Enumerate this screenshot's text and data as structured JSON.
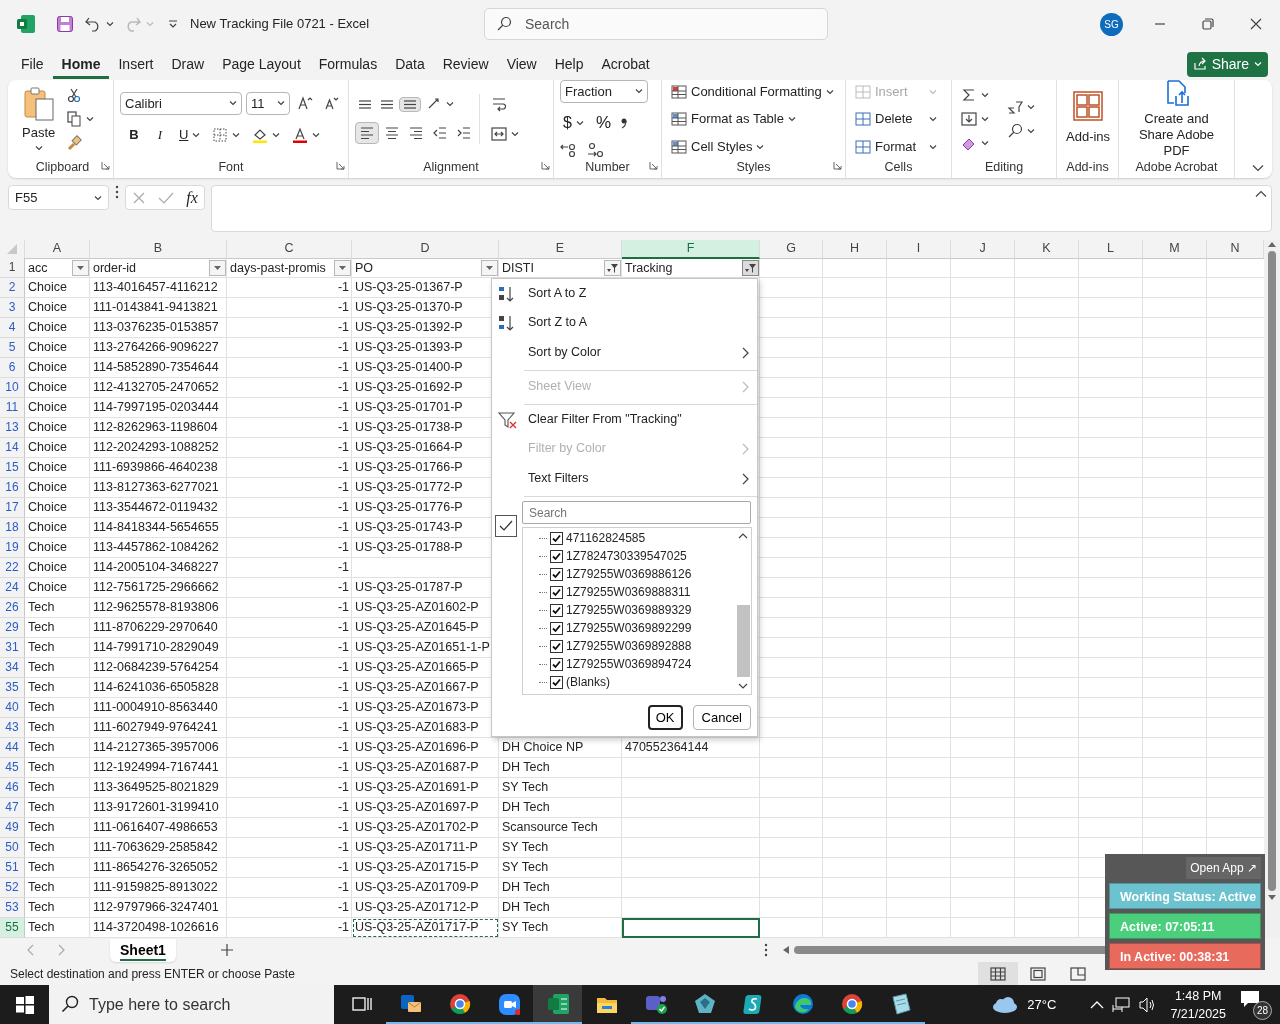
{
  "window": {
    "title": "New Tracking File 0721  -  Excel",
    "search_placeholder": "Search",
    "avatar": "SG"
  },
  "menu_tabs": [
    {
      "label": "File",
      "selected": false
    },
    {
      "label": "Home",
      "selected": true
    },
    {
      "label": "Insert",
      "selected": false
    },
    {
      "label": "Draw",
      "selected": false
    },
    {
      "label": "Page Layout",
      "selected": false
    },
    {
      "label": "Formulas",
      "selected": false
    },
    {
      "label": "Data",
      "selected": false
    },
    {
      "label": "Review",
      "selected": false
    },
    {
      "label": "View",
      "selected": false
    },
    {
      "label": "Help",
      "selected": false
    },
    {
      "label": "Acrobat",
      "selected": false
    }
  ],
  "share_button": "Share",
  "ribbon": {
    "groups": [
      {
        "kind": "clipboard",
        "label": "Clipboard",
        "button": "Paste",
        "launcher": true
      },
      {
        "kind": "font",
        "label": "Font",
        "font": "Calibri",
        "size": "11",
        "bold": "B",
        "italic": "I",
        "underline": "U",
        "launcher": true
      },
      {
        "kind": "alignment",
        "label": "Alignment",
        "vertical_align": [
          {
            "selected": false
          },
          {
            "selected": false
          },
          {
            "selected": true
          }
        ],
        "horizontal_align": [
          {
            "selected": true
          },
          {
            "selected": false
          },
          {
            "selected": false
          }
        ],
        "launcher": true
      },
      {
        "kind": "number",
        "label": "Number",
        "format": "Fraction",
        "currency": "$",
        "percent": "%",
        "launcher": true
      },
      {
        "kind": "styles",
        "label": "Styles",
        "items": [
          "Conditional Formatting",
          "Format as Table",
          "Cell Styles"
        ],
        "launcher": true
      },
      {
        "kind": "cells",
        "label": "Cells",
        "items": [
          {
            "label": "Insert",
            "disabled": true
          },
          {
            "label": "Delete",
            "disabled": false
          },
          {
            "label": "Format",
            "disabled": false
          }
        ],
        "launcher": false
      },
      {
        "kind": "editing",
        "label": "Editing",
        "launcher": false
      },
      {
        "kind": "addins",
        "label": "Add-ins",
        "button": "Add-ins",
        "launcher": false
      },
      {
        "kind": "acrobat",
        "label": "Adobe Acrobat",
        "button": "Create and Share Adobe PDF",
        "launcher": false
      }
    ]
  },
  "formula_bar": {
    "name_box": "F55",
    "fx": "fx"
  },
  "sheet": {
    "columns": [
      {
        "letter": "A",
        "kind": "text",
        "selected": false
      },
      {
        "letter": "B",
        "kind": "text",
        "selected": false
      },
      {
        "letter": "C",
        "kind": "number",
        "selected": false
      },
      {
        "letter": "D",
        "kind": "text",
        "selected": false
      },
      {
        "letter": "E",
        "kind": "text",
        "selected": false
      },
      {
        "letter": "F",
        "kind": "text",
        "selected": true
      },
      {
        "letter": "G",
        "kind": "text",
        "selected": false
      },
      {
        "letter": "H",
        "kind": "text",
        "selected": false
      },
      {
        "letter": "I",
        "kind": "text",
        "selected": false
      },
      {
        "letter": "J",
        "kind": "text",
        "selected": false
      },
      {
        "letter": "K",
        "kind": "text",
        "selected": false
      },
      {
        "letter": "L",
        "kind": "text",
        "selected": false
      },
      {
        "letter": "M",
        "kind": "text",
        "selected": false
      },
      {
        "letter": "N",
        "kind": "text",
        "selected": false
      }
    ],
    "header": {
      "num": "1",
      "cells": [
        {
          "text": "acc",
          "filtered": false
        },
        {
          "text": "order-id",
          "filtered": false
        },
        {
          "text": "days-past-promis",
          "filtered": false
        },
        {
          "text": "PO",
          "filtered": false
        },
        {
          "text": "DISTI",
          "filtered": true
        },
        {
          "text": "Tracking",
          "filtered": true
        }
      ]
    },
    "rows": [
      {
        "num": "2",
        "cells": [
          "Choice",
          "113-4016457-4116212",
          "-1",
          "US-Q3-25-01367-P"
        ],
        "selected": false
      },
      {
        "num": "3",
        "cells": [
          "Choice",
          "111-0143841-9413821",
          "-1",
          "US-Q3-25-01370-P"
        ],
        "selected": false
      },
      {
        "num": "4",
        "cells": [
          "Choice",
          "113-0376235-0153857",
          "-1",
          "US-Q3-25-01392-P"
        ],
        "selected": false
      },
      {
        "num": "5",
        "cells": [
          "Choice",
          "113-2764266-9096227",
          "-1",
          "US-Q3-25-01393-P"
        ],
        "selected": false
      },
      {
        "num": "6",
        "cells": [
          "Choice",
          "114-5852890-7354644",
          "-1",
          "US-Q3-25-01400-P"
        ],
        "selected": false
      },
      {
        "num": "10",
        "cells": [
          "Choice",
          "112-4132705-2470652",
          "-1",
          "US-Q3-25-01692-P"
        ],
        "selected": false
      },
      {
        "num": "11",
        "cells": [
          "Choice",
          "114-7997195-0203444",
          "-1",
          "US-Q3-25-01701-P"
        ],
        "selected": false
      },
      {
        "num": "13",
        "cells": [
          "Choice",
          "112-8262963-1198604",
          "-1",
          "US-Q3-25-01738-P"
        ],
        "selected": false
      },
      {
        "num": "14",
        "cells": [
          "Choice",
          "112-2024293-1088252",
          "-1",
          "US-Q3-25-01664-P"
        ],
        "selected": false
      },
      {
        "num": "15",
        "cells": [
          "Choice",
          "111-6939866-4640238",
          "-1",
          "US-Q3-25-01766-P"
        ],
        "selected": false
      },
      {
        "num": "16",
        "cells": [
          "Choice",
          "113-8127363-6277021",
          "-1",
          "US-Q3-25-01772-P"
        ],
        "selected": false
      },
      {
        "num": "17",
        "cells": [
          "Choice",
          "113-3544672-0119432",
          "-1",
          "US-Q3-25-01776-P"
        ],
        "selected": false
      },
      {
        "num": "18",
        "cells": [
          "Choice",
          "114-8418344-5654655",
          "-1",
          "US-Q3-25-01743-P"
        ],
        "selected": false
      },
      {
        "num": "19",
        "cells": [
          "Choice",
          "113-4457862-1084262",
          "-1",
          "US-Q3-25-01788-P"
        ],
        "selected": false
      },
      {
        "num": "22",
        "cells": [
          "Choice",
          "114-2005104-3468227",
          "-1"
        ],
        "selected": false
      },
      {
        "num": "24",
        "cells": [
          "Choice",
          "112-7561725-2966662",
          "-1",
          "US-Q3-25-01787-P"
        ],
        "selected": false
      },
      {
        "num": "26",
        "cells": [
          "Tech",
          "112-9625578-8193806",
          "-1",
          "US-Q3-25-AZ01602-P"
        ],
        "selected": false
      },
      {
        "num": "29",
        "cells": [
          "Tech",
          "111-8706229-2970640",
          "-1",
          "US-Q3-25-AZ01645-P"
        ],
        "selected": false
      },
      {
        "num": "31",
        "cells": [
          "Tech",
          "114-7991710-2829049",
          "-1",
          "US-Q3-25-AZ01651-1-P"
        ],
        "selected": false
      },
      {
        "num": "34",
        "cells": [
          "Tech",
          "112-0684239-5764254",
          "-1",
          "US-Q3-25-AZ01665-P"
        ],
        "selected": false
      },
      {
        "num": "35",
        "cells": [
          "Tech",
          "114-6241036-6505828",
          "-1",
          "US-Q3-25-AZ01667-P"
        ],
        "selected": false
      },
      {
        "num": "40",
        "cells": [
          "Tech",
          "111-0004910-8563440",
          "-1",
          "US-Q3-25-AZ01673-P"
        ],
        "selected": false
      },
      {
        "num": "43",
        "cells": [
          "Tech",
          "111-6027949-9764241",
          "-1",
          "US-Q3-25-AZ01683-P"
        ],
        "selected": false
      },
      {
        "num": "44",
        "cells": [
          "Tech",
          "114-2127365-3957006",
          "-1",
          "US-Q3-25-AZ01696-P",
          "DH Choice NP",
          "470552364144"
        ],
        "selected": false
      },
      {
        "num": "45",
        "cells": [
          "Tech",
          "112-1924994-7167441",
          "-1",
          "US-Q3-25-AZ01687-P",
          "DH Tech"
        ],
        "selected": false
      },
      {
        "num": "46",
        "cells": [
          "Tech",
          "113-3649525-8021829",
          "-1",
          "US-Q3-25-AZ01691-P",
          "SY Tech"
        ],
        "selected": false
      },
      {
        "num": "47",
        "cells": [
          "Tech",
          "113-9172601-3199410",
          "-1",
          "US-Q3-25-AZ01697-P",
          "DH Tech"
        ],
        "selected": false
      },
      {
        "num": "49",
        "cells": [
          "Tech",
          "111-0616407-4986653",
          "-1",
          "US-Q3-25-AZ01702-P",
          "Scansource Tech"
        ],
        "selected": false
      },
      {
        "num": "50",
        "cells": [
          "Tech",
          "111-7063629-2585842",
          "-1",
          "US-Q3-25-AZ01711-P",
          "SY Tech"
        ],
        "selected": false
      },
      {
        "num": "51",
        "cells": [
          "Tech",
          "111-8654276-3265052",
          "-1",
          "US-Q3-25-AZ01715-P",
          "SY Tech"
        ],
        "selected": false
      },
      {
        "num": "52",
        "cells": [
          "Tech",
          "111-9159825-8913022",
          "-1",
          "US-Q3-25-AZ01709-P",
          "DH Tech"
        ],
        "selected": false
      },
      {
        "num": "53",
        "cells": [
          "Tech",
          "112-9797966-3247401",
          "-1",
          "US-Q3-25-AZ01712-P",
          "DH Tech"
        ],
        "selected": false
      },
      {
        "num": "55",
        "cells": [
          "Tech",
          "114-3720498-1026616",
          "-1",
          "US-Q3-25-AZ01717-P",
          "SY Tech"
        ],
        "selected": true,
        "copied_cells": [
          false,
          false,
          false,
          true,
          false
        ]
      }
    ]
  },
  "filter_menu": {
    "items": [
      {
        "label": "Sort A to Z",
        "kind": "sort-asc",
        "disabled": false,
        "submenu": false,
        "divider_after": false
      },
      {
        "label": "Sort Z to A",
        "kind": "sort-desc",
        "disabled": false,
        "submenu": false,
        "divider_after": false
      },
      {
        "label": "Sort by Color",
        "kind": "plain",
        "disabled": false,
        "submenu": true,
        "divider_after": true
      },
      {
        "label": "Sheet View",
        "kind": "plain",
        "disabled": true,
        "submenu": true,
        "divider_after": true
      },
      {
        "label": "Clear Filter From \"Tracking\"",
        "kind": "clear-filter",
        "disabled": false,
        "submenu": false,
        "divider_after": false
      },
      {
        "label": "Filter by Color",
        "kind": "plain",
        "disabled": true,
        "submenu": true,
        "divider_after": false
      },
      {
        "label": "Text Filters",
        "kind": "plain",
        "disabled": false,
        "submenu": true,
        "divider_after": true
      }
    ],
    "search_placeholder": "Search",
    "select_all_checked": true,
    "values": [
      {
        "label": "471162824585",
        "checked": true
      },
      {
        "label": "1Z7824730339547025",
        "checked": true
      },
      {
        "label": "1Z79255W0369886126",
        "checked": true
      },
      {
        "label": "1Z79255W0369888311",
        "checked": true
      },
      {
        "label": "1Z79255W0369889329",
        "checked": true
      },
      {
        "label": "1Z79255W0369892299",
        "checked": true
      },
      {
        "label": "1Z79255W0369892888",
        "checked": true
      },
      {
        "label": "1Z79255W0369894724",
        "checked": true
      },
      {
        "label": "(Blanks)",
        "checked": true
      }
    ],
    "ok": "OK",
    "cancel": "Cancel"
  },
  "sheet_tabs": [
    {
      "label": "Sheet1",
      "selected": true
    }
  ],
  "status_bar": {
    "message": "Select destination and press ENTER or choose Paste",
    "views": [
      {
        "selected": true
      },
      {
        "selected": false
      },
      {
        "selected": false
      }
    ]
  },
  "status_widget": {
    "open_app": "Open App ↗",
    "rows": [
      {
        "text": "Working Status: Active",
        "color": "#6cc3cf"
      },
      {
        "text": "Active: 07:05:11",
        "color": "#4ccf7d"
      },
      {
        "text": "In Active: 00:38:31",
        "color": "#e86a5c"
      }
    ]
  },
  "taskbar": {
    "search_placeholder": "Type here to search",
    "apps": [
      {
        "kind": "task-view",
        "running": false,
        "active": false
      },
      {
        "kind": "mail",
        "running": true,
        "active": false
      },
      {
        "kind": "browser",
        "running": true,
        "active": false
      },
      {
        "kind": "video",
        "running": true,
        "active": false
      },
      {
        "kind": "sheet",
        "running": true,
        "active": true
      },
      {
        "kind": "folder",
        "running": false,
        "active": false
      },
      {
        "kind": "chat",
        "running": true,
        "active": false
      },
      {
        "kind": "gem",
        "running": true,
        "active": false
      },
      {
        "kind": "script",
        "running": true,
        "active": false
      },
      {
        "kind": "wave",
        "running": true,
        "active": false
      },
      {
        "kind": "browser",
        "running": true,
        "active": false
      },
      {
        "kind": "notepad",
        "running": true,
        "active": false
      }
    ],
    "weather": "27°C",
    "time": "1:48 PM",
    "date": "7/21/2025",
    "notifications": "28"
  }
}
